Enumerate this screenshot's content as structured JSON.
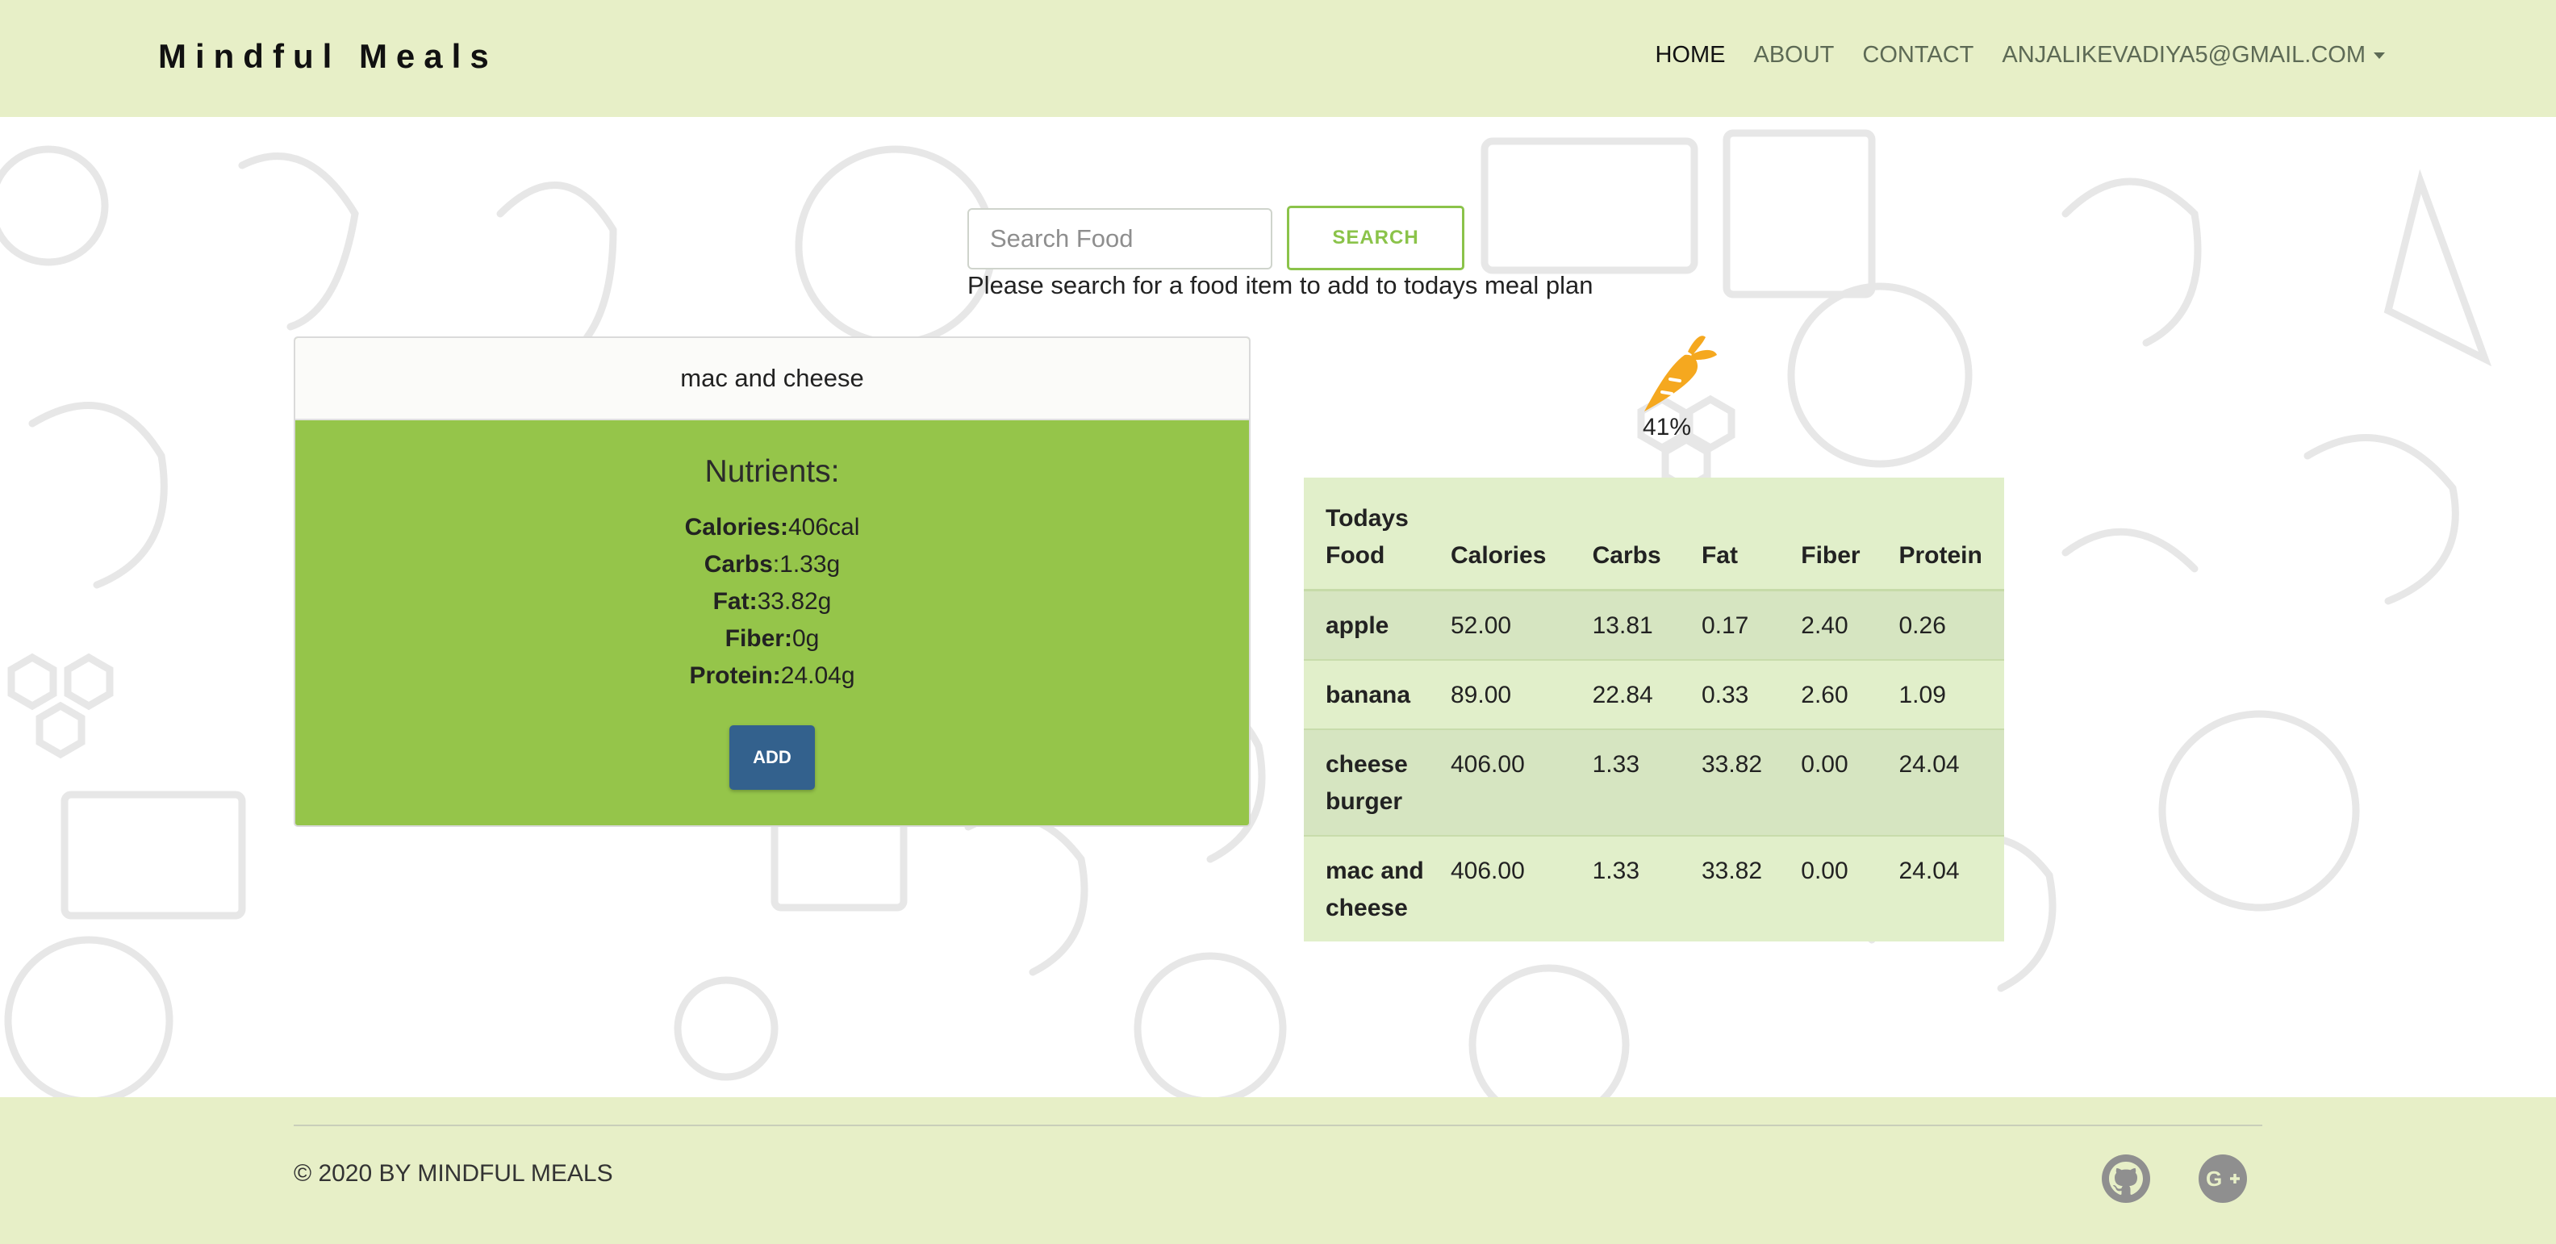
{
  "brand": "Mindful Meals",
  "nav": {
    "home": "HOME",
    "about": "ABOUT",
    "contact": "CONTACT",
    "user": "ANJALIKEVADIYA5@GMAIL.COM"
  },
  "search": {
    "placeholder": "Search Food",
    "button": "SEARCH",
    "hint": "Please search for a food item to add to todays meal plan"
  },
  "food_card": {
    "name": "mac and cheese",
    "title": "Nutrients:",
    "nutrients": [
      {
        "label": "Calories:",
        "value": "406cal"
      },
      {
        "label": "Carbs",
        "value": ":1.33g"
      },
      {
        "label": "Fat:",
        "value": "33.82g"
      },
      {
        "label": "Fiber:",
        "value": "0g"
      },
      {
        "label": "Protein:",
        "value": "24.04g"
      }
    ],
    "add_button": "ADD"
  },
  "progress": {
    "percent": 41,
    "label": "41%",
    "icon": "carrot-icon"
  },
  "table": {
    "headers": [
      "Todays Food",
      "Calories",
      "Carbs",
      "Fat",
      "Fiber",
      "Protein"
    ],
    "rows": [
      [
        "apple",
        "52.00",
        "13.81",
        "0.17",
        "2.40",
        "0.26"
      ],
      [
        "banana",
        "89.00",
        "22.84",
        "0.33",
        "2.60",
        "1.09"
      ],
      [
        "cheese burger",
        "406.00",
        "1.33",
        "33.82",
        "0.00",
        "24.04"
      ],
      [
        "mac and cheese",
        "406.00",
        "1.33",
        "33.82",
        "0.00",
        "24.04"
      ]
    ]
  },
  "footer": {
    "copyright": "© 2020 BY MINDFUL MEALS",
    "icons": [
      "github-icon",
      "google-plus-icon"
    ]
  },
  "colors": {
    "header_bg": "#e7efc7",
    "card_green": "#95c54a",
    "search_green": "#8bc34a",
    "add_blue": "#33618d",
    "carrot_orange": "#f5a81f",
    "table_light": "#e1efca",
    "table_dark": "#d6e5c1"
  }
}
